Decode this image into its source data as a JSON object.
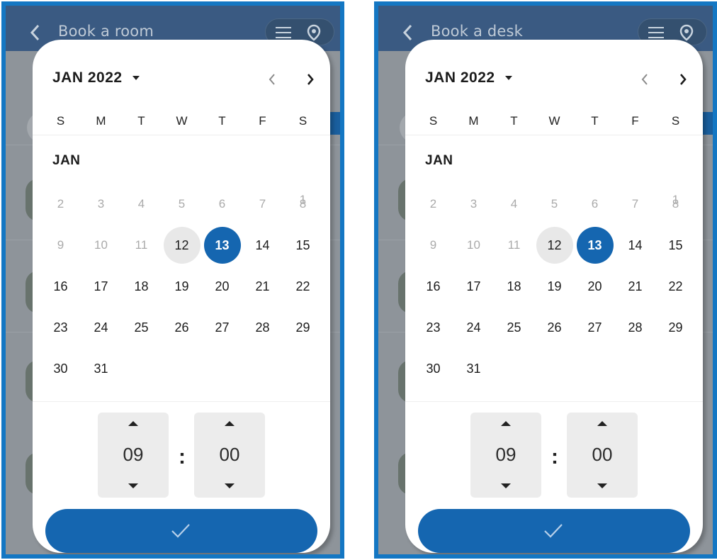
{
  "screens": [
    {
      "title": "Book a room",
      "picker": {
        "month_label": "JAN 2022",
        "weekdays": [
          "S",
          "M",
          "T",
          "W",
          "T",
          "F",
          "S"
        ],
        "section_label": "JAN",
        "days": [
          "1",
          "2",
          "3",
          "4",
          "5",
          "6",
          "7",
          "8",
          "9",
          "10",
          "11",
          "12",
          "13",
          "14",
          "15",
          "16",
          "17",
          "18",
          "19",
          "20",
          "21",
          "22",
          "23",
          "24",
          "25",
          "26",
          "27",
          "28",
          "29",
          "30",
          "31"
        ],
        "today": "12",
        "selected": "13",
        "hour": "09",
        "minute": "00",
        "separator": ":"
      }
    },
    {
      "title": "Book a desk",
      "picker": {
        "month_label": "JAN 2022",
        "weekdays": [
          "S",
          "M",
          "T",
          "W",
          "T",
          "F",
          "S"
        ],
        "section_label": "JAN",
        "days": [
          "1",
          "2",
          "3",
          "4",
          "5",
          "6",
          "7",
          "8",
          "9",
          "10",
          "11",
          "12",
          "13",
          "14",
          "15",
          "16",
          "17",
          "18",
          "19",
          "20",
          "21",
          "22",
          "23",
          "24",
          "25",
          "26",
          "27",
          "28",
          "29",
          "30",
          "31"
        ],
        "today": "12",
        "selected": "13",
        "hour": "09",
        "minute": "00",
        "separator": ":"
      }
    }
  ],
  "icons": {
    "back": "chevron-left-icon",
    "menu": "menu-icon",
    "location": "location-pin-icon",
    "prev": "chevron-left-icon",
    "next": "chevron-right-icon",
    "dropdown": "caret-down-icon",
    "confirm": "check-icon"
  },
  "colors": {
    "accent": "#1566b0",
    "frame": "#1477c3",
    "appbar": "#3a5a82",
    "today_bg": "#e8e8e8"
  }
}
